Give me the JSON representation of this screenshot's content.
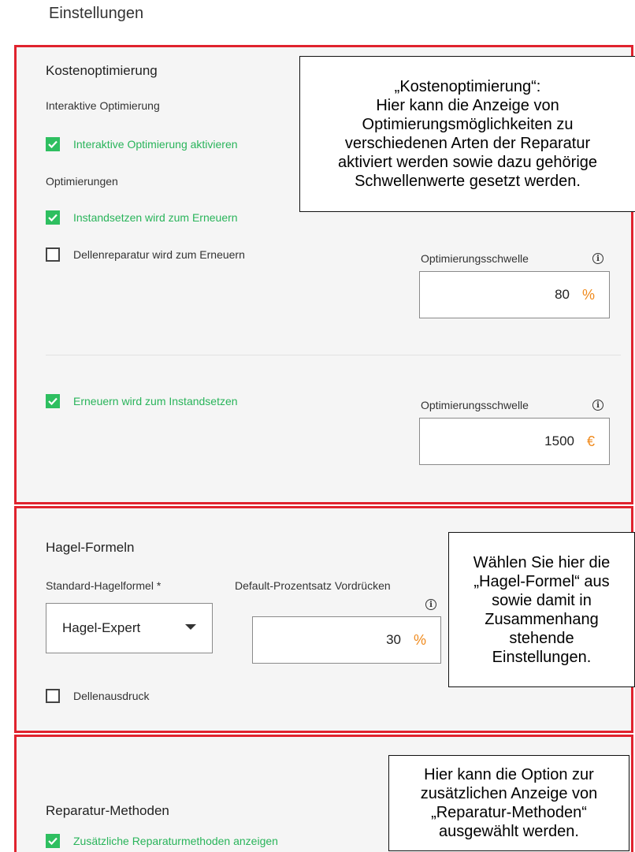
{
  "page": {
    "title": "Einstellungen"
  },
  "colors": {
    "panel_border": "#e0232e",
    "checkbox_checked": "#2ebf60",
    "checked_label": "#29b45a",
    "unit": "#f08a1c"
  },
  "cost_optimization": {
    "title": "Kostenoptimierung",
    "interactive_label": "Interaktive Optimierung",
    "interactive_checkbox": {
      "label": "Interaktive Optimierung aktivieren",
      "checked": true
    },
    "optimizations_label": "Optimierungen",
    "repair_to_renew": {
      "label": "Instandsetzen wird zum Erneuern",
      "checked": true
    },
    "dent_to_renew": {
      "label": "Dellenreparatur wird zum Erneuern",
      "checked": false
    },
    "threshold1": {
      "label": "Optimierungsschwelle",
      "value": "80",
      "unit": "%"
    },
    "renew_to_repair": {
      "label": "Erneuern wird zum Instandsetzen",
      "checked": true
    },
    "threshold2": {
      "label": "Optimierungsschwelle",
      "value": "1500",
      "unit": "€"
    },
    "callout": [
      "„Kostenoptimierung“:",
      "Hier kann die Anzeige von",
      "Optimierungsmöglichkeiten zu",
      "verschiedenen Arten der Reparatur",
      "aktiviert werden sowie dazu gehörige",
      "Schwellenwerte gesetzt werden."
    ]
  },
  "hail": {
    "title": "Hagel-Formeln",
    "formula_label": "Standard-Hagelformel *",
    "formula_value": "Hagel-Expert",
    "percent_label": "Default-Prozentsatz Vordrücken",
    "percent_value": "30",
    "percent_unit": "%",
    "dent_print": {
      "label": "Dellenausdruck",
      "checked": false
    },
    "callout": [
      "Wählen Sie hier die",
      "„Hagel-Formel“ aus",
      "sowie damit in",
      "Zusammenhang",
      "stehende",
      "Einstellungen."
    ]
  },
  "repair_methods": {
    "title": "Reparatur-Methoden",
    "show_additional": {
      "label": "Zusätzliche Reparaturmethoden anzeigen",
      "checked": true
    },
    "callout": [
      "Hier kann die Option zur",
      "zusätzlichen Anzeige von",
      "„Reparatur-Methoden“",
      "ausgewählt werden."
    ]
  }
}
